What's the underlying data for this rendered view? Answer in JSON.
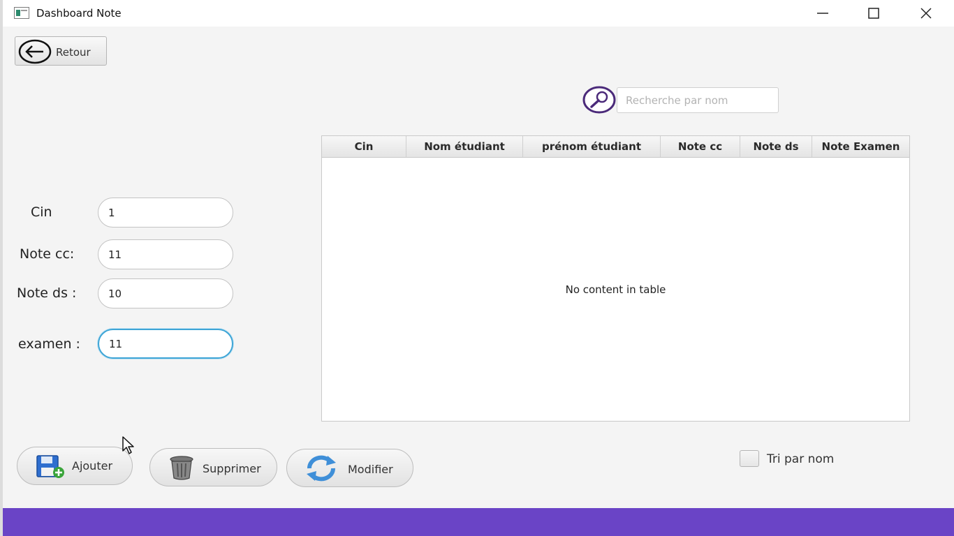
{
  "window": {
    "title": "Dashboard Note",
    "minimize_icon": "minimize-icon",
    "maximize_icon": "maximize-icon",
    "close_icon": "close-icon"
  },
  "toolbar": {
    "back_label": "Retour",
    "back_icon": "arrow-left-circle-icon"
  },
  "search": {
    "placeholder": "Recherche par nom",
    "value": "",
    "icon": "search-icon"
  },
  "table": {
    "columns": [
      "Cin",
      "Nom étudiant",
      "prénom étudiant",
      "Note cc",
      "Note ds",
      "Note Examen"
    ],
    "rows": [],
    "empty_message": "No content in table"
  },
  "form": {
    "cin": {
      "label": "Cin",
      "value": "1"
    },
    "note_cc": {
      "label": "Note cc:",
      "value": "11"
    },
    "note_ds": {
      "label": "Note ds :",
      "value": "10"
    },
    "examen": {
      "label": "examen :",
      "value": "11"
    }
  },
  "actions": {
    "add_label": "Ajouter",
    "delete_label": "Supprimer",
    "modify_label": "Modifier"
  },
  "sort": {
    "label": "Tri par nom",
    "checked": false
  },
  "colors": {
    "footer": "#6a44c6",
    "focus_ring": "#3ea5d6",
    "search_icon": "#4b2a7a"
  }
}
